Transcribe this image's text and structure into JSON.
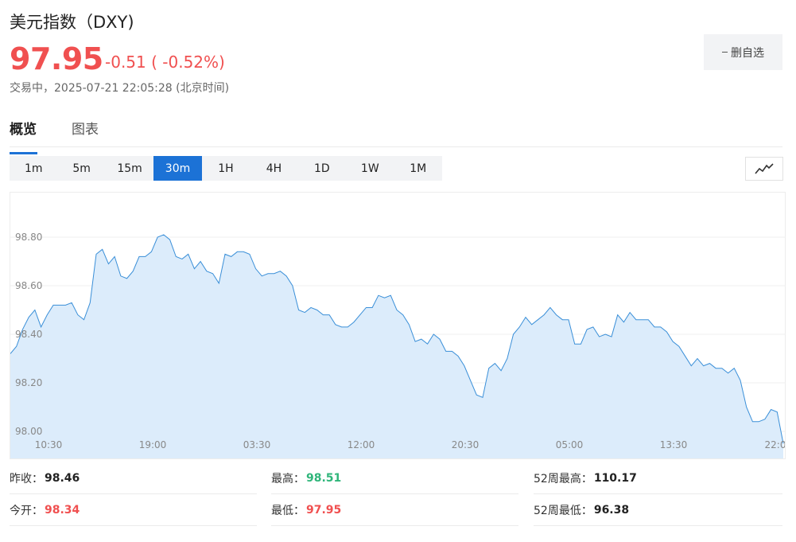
{
  "header": {
    "title": "美元指数（DXY)",
    "price": "97.95",
    "change": "-0.51 ( -0.52%)",
    "status_label": "交易中，",
    "timestamp": "2025-07-21 22:05:28 (北京时间)",
    "watch_button": "删自选"
  },
  "tabs": [
    {
      "label": "概览",
      "active": true
    },
    {
      "label": "图表",
      "active": false
    }
  ],
  "intervals": [
    {
      "label": "1m"
    },
    {
      "label": "5m"
    },
    {
      "label": "15m"
    },
    {
      "label": "30m",
      "active": true
    },
    {
      "label": "1H"
    },
    {
      "label": "4H"
    },
    {
      "label": "1D"
    },
    {
      "label": "1W"
    },
    {
      "label": "1M"
    }
  ],
  "chart_type_icon": "line-chart-icon",
  "colors": {
    "accent": "#1c72d6",
    "up": "#f05050",
    "down": "#2fb57a",
    "line": "#3a8fd8",
    "fill": "#dcecfb"
  },
  "chart_data": {
    "type": "area",
    "ylim": [
      97.95,
      98.9
    ],
    "y_ticks": [
      98.0,
      98.2,
      98.4,
      98.6,
      98.8
    ],
    "y_tick_labels": [
      "98.00",
      "98.20",
      "98.40",
      "98.60",
      "98.80"
    ],
    "x_tick_labels": [
      "10:30",
      "19:00",
      "03:30",
      "12:00",
      "20:30",
      "05:00",
      "13:30",
      "22:0"
    ],
    "grid": true,
    "values": [
      98.32,
      98.35,
      98.42,
      98.47,
      98.5,
      98.43,
      98.48,
      98.52,
      98.52,
      98.52,
      98.53,
      98.48,
      98.46,
      98.53,
      98.73,
      98.75,
      98.69,
      98.72,
      98.64,
      98.63,
      98.66,
      98.72,
      98.72,
      98.74,
      98.8,
      98.81,
      98.79,
      98.72,
      98.71,
      98.73,
      98.67,
      98.7,
      98.66,
      98.65,
      98.61,
      98.73,
      98.72,
      98.74,
      98.74,
      98.73,
      98.67,
      98.64,
      98.65,
      98.65,
      98.66,
      98.64,
      98.6,
      98.5,
      98.49,
      98.51,
      98.5,
      98.48,
      98.48,
      98.44,
      98.43,
      98.43,
      98.45,
      98.48,
      98.51,
      98.51,
      98.56,
      98.55,
      98.56,
      98.5,
      98.48,
      98.44,
      98.37,
      98.38,
      98.36,
      98.4,
      98.38,
      98.33,
      98.33,
      98.31,
      98.27,
      98.21,
      98.15,
      98.14,
      98.26,
      98.28,
      98.25,
      98.3,
      98.4,
      98.43,
      98.47,
      98.44,
      98.46,
      98.48,
      98.51,
      98.48,
      98.46,
      98.46,
      98.36,
      98.36,
      98.42,
      98.43,
      98.39,
      98.4,
      98.39,
      98.48,
      98.45,
      98.49,
      98.46,
      98.46,
      98.46,
      98.43,
      98.43,
      98.41,
      98.37,
      98.35,
      98.31,
      98.27,
      98.3,
      98.27,
      98.28,
      98.26,
      98.26,
      98.24,
      98.26,
      98.21,
      98.1,
      98.04,
      98.04,
      98.05,
      98.09,
      98.08,
      97.95
    ]
  },
  "stats": {
    "prev_close_label": "昨收：",
    "prev_close": "98.46",
    "open_label": "今开：",
    "open": "98.34",
    "high_label": "最高：",
    "high": "98.51",
    "low_label": "最低：",
    "low": "97.95",
    "w52_high_label": "52周最高：",
    "w52_high": "110.17",
    "w52_low_label": "52周最低：",
    "w52_low": "96.38"
  }
}
